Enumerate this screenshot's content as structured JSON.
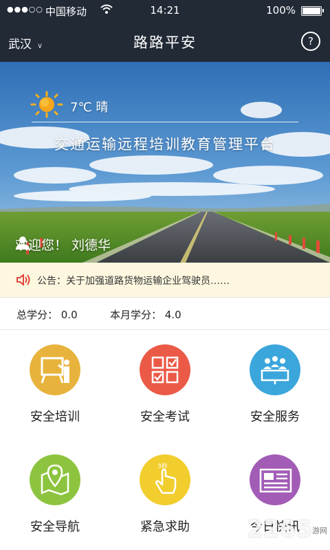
{
  "status_bar": {
    "signal": "●●●○○",
    "carrier": "中国移动",
    "time": "14:21",
    "battery": "100%"
  },
  "nav": {
    "city": "武汉",
    "title": "路路平安",
    "help_icon": "?"
  },
  "banner": {
    "temperature": "7℃",
    "condition": "晴",
    "weather_text": "7℃ 晴",
    "platform_title": "交通运输远程培训教育管理平台",
    "welcome": "欢迎您！ 刘德华"
  },
  "notice": {
    "text": "公告：关于加强道路货物运输企业驾驶员……"
  },
  "scores": {
    "total_label": "总学分：",
    "total_value": "0.0",
    "total": "总学分： 0.0",
    "month_label": "本月学分：",
    "month_value": "4.0",
    "month": "本月学分： 4.0"
  },
  "menu": [
    {
      "label": "安全培训",
      "icon": "presentation-icon",
      "color": "#e8b33c"
    },
    {
      "label": "安全考试",
      "icon": "checklist-grid-icon",
      "color": "#ea5a47"
    },
    {
      "label": "安全服务",
      "icon": "service-group-icon",
      "color": "#3aa6db"
    },
    {
      "label": "安全导航",
      "icon": "map-pin-icon",
      "color": "#8dc43f"
    },
    {
      "label": "紧急求助",
      "icon": "tap-hand-icon",
      "color": "#f2cd2e"
    },
    {
      "label": "今日快讯",
      "icon": "newspaper-icon",
      "color": "#a25cb6"
    }
  ],
  "watermark": {
    "text": "2265",
    "suffix": "游网"
  }
}
